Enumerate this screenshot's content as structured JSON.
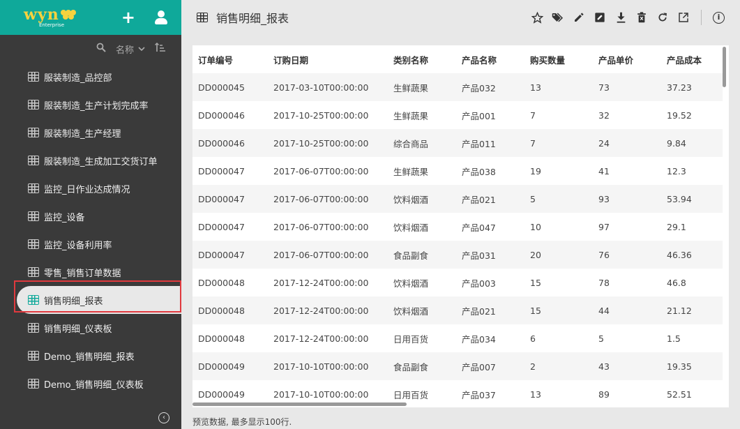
{
  "brand": {
    "logo_main": "wyn",
    "logo_sub": "Enterprise",
    "add_label": "+"
  },
  "sidebar": {
    "sort_label": "名称",
    "items": [
      {
        "label": "服装制造_品控部"
      },
      {
        "label": "服装制造_生产计划完成率"
      },
      {
        "label": "服装制造_生产经理"
      },
      {
        "label": "服装制造_生成加工交货订单"
      },
      {
        "label": "监控_日作业达成情况"
      },
      {
        "label": "监控_设备"
      },
      {
        "label": "监控_设备利用率"
      },
      {
        "label": "零售_销售订单数据"
      },
      {
        "label": "销售明细_报表",
        "active": true
      },
      {
        "label": "销售明细_仪表板"
      },
      {
        "label": "Demo_销售明细_报表"
      },
      {
        "label": "Demo_销售明细_仪表板"
      }
    ]
  },
  "header": {
    "title": "销售明细_报表",
    "toolbar_icons": [
      "star-icon",
      "tag-icon",
      "pencil-icon",
      "edit-box-icon",
      "download-icon",
      "delete-icon",
      "refresh-icon",
      "open-external-icon",
      "info-icon"
    ]
  },
  "table": {
    "columns": [
      "订单编号",
      "订购日期",
      "类别名称",
      "产品名称",
      "购买数量",
      "产品单价",
      "产品成本"
    ],
    "rows": [
      [
        "DD000045",
        "2017-03-10T00:00:00",
        "生鲜蔬果",
        "产品032",
        "13",
        "73",
        "37.23"
      ],
      [
        "DD000046",
        "2017-10-25T00:00:00",
        "生鲜蔬果",
        "产品001",
        "7",
        "32",
        "19.52"
      ],
      [
        "DD000046",
        "2017-10-25T00:00:00",
        "综合商品",
        "产品011",
        "7",
        "24",
        "9.84"
      ],
      [
        "DD000047",
        "2017-06-07T00:00:00",
        "生鲜蔬果",
        "产品038",
        "19",
        "41",
        "12.3"
      ],
      [
        "DD000047",
        "2017-06-07T00:00:00",
        "饮料烟酒",
        "产品021",
        "5",
        "93",
        "53.94"
      ],
      [
        "DD000047",
        "2017-06-07T00:00:00",
        "饮料烟酒",
        "产品047",
        "10",
        "97",
        "29.1"
      ],
      [
        "DD000047",
        "2017-06-07T00:00:00",
        "食品副食",
        "产品031",
        "20",
        "76",
        "46.36"
      ],
      [
        "DD000048",
        "2017-12-24T00:00:00",
        "饮料烟酒",
        "产品003",
        "15",
        "78",
        "46.8"
      ],
      [
        "DD000048",
        "2017-12-24T00:00:00",
        "饮料烟酒",
        "产品021",
        "15",
        "44",
        "21.12"
      ],
      [
        "DD000048",
        "2017-12-24T00:00:00",
        "日用百货",
        "产品034",
        "6",
        "5",
        "1.5"
      ],
      [
        "DD000049",
        "2017-10-10T00:00:00",
        "食品副食",
        "产品007",
        "2",
        "43",
        "19.35"
      ],
      [
        "DD000049",
        "2017-10-10T00:00:00",
        "日用百货",
        "产品037",
        "13",
        "89",
        "52.51"
      ]
    ]
  },
  "footer": {
    "note": "预览数据, 最多显示100行."
  },
  "colors": {
    "accent": "#0fa99a",
    "logo": "#f7d23e",
    "sidebar_bg": "#3a3a3a",
    "highlight": "#e0393e"
  }
}
